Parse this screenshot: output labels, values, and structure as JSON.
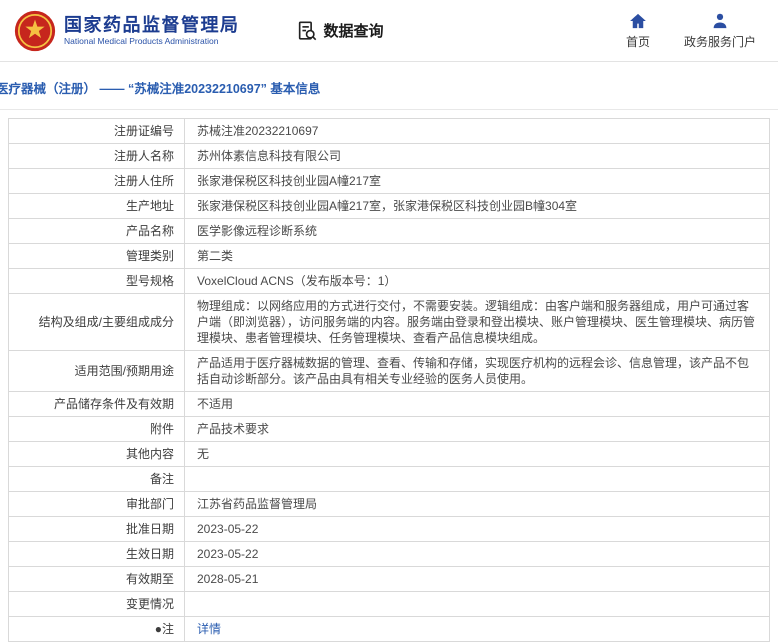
{
  "header": {
    "agency_cn": "国家药品监督管理局",
    "agency_en": "National Medical Products Administration",
    "nav_query": "数据查询",
    "nav_home": "首页",
    "nav_portal": "政务服务门户"
  },
  "icons": {
    "emblem": "national-emblem-red-badge",
    "query": "document-magnifier",
    "home": "house",
    "portal": "person"
  },
  "colors": {
    "brand_blue": "#1c3c90",
    "link_blue": "#2a5db0",
    "emblem_red": "#c6261d",
    "border_gray": "#d9d9d9"
  },
  "breadcrumb": {
    "text": "医疗器械（注册） —— “苏械注准20232210697” 基本信息"
  },
  "table": {
    "rows": [
      {
        "label": "注册证编号",
        "value": "苏械注准20232210697"
      },
      {
        "label": "注册人名称",
        "value": "苏州体素信息科技有限公司"
      },
      {
        "label": "注册人住所",
        "value": "张家港保税区科技创业园A幢217室"
      },
      {
        "label": "生产地址",
        "value": "张家港保税区科技创业园A幢217室，张家港保税区科技创业园B幢304室"
      },
      {
        "label": "产品名称",
        "value": "医学影像远程诊断系统"
      },
      {
        "label": "管理类别",
        "value": "第二类"
      },
      {
        "label": "型号规格",
        "value": "VoxelCloud ACNS（发布版本号：1）"
      },
      {
        "label": "结构及组成/主要组成成分",
        "value": "物理组成：以网络应用的方式进行交付，不需要安装。逻辑组成：由客户端和服务器组成，用户可通过客户端（即浏览器），访问服务端的内容。服务端由登录和登出模块、账户管理模块、医生管理模块、病历管理模块、患者管理模块、任务管理模块、查看产品信息模块组成。"
      },
      {
        "label": "适用范围/预期用途",
        "value": "产品适用于医疗器械数据的管理、查看、传输和存储，实现医疗机构的远程会诊、信息管理，该产品不包括自动诊断部分。该产品由具有相关专业经验的医务人员使用。"
      },
      {
        "label": "产品储存条件及有效期",
        "value": "不适用"
      },
      {
        "label": "附件",
        "value": "产品技术要求"
      },
      {
        "label": "其他内容",
        "value": "无"
      },
      {
        "label": "备注",
        "value": ""
      },
      {
        "label": "审批部门",
        "value": "江苏省药品监督管理局"
      },
      {
        "label": "批准日期",
        "value": "2023-05-22"
      },
      {
        "label": "生效日期",
        "value": "2023-05-22"
      },
      {
        "label": "有效期至",
        "value": "2028-05-21"
      },
      {
        "label": "变更情况",
        "value": ""
      },
      {
        "label": "●注",
        "value": "详情",
        "link": true
      }
    ]
  }
}
